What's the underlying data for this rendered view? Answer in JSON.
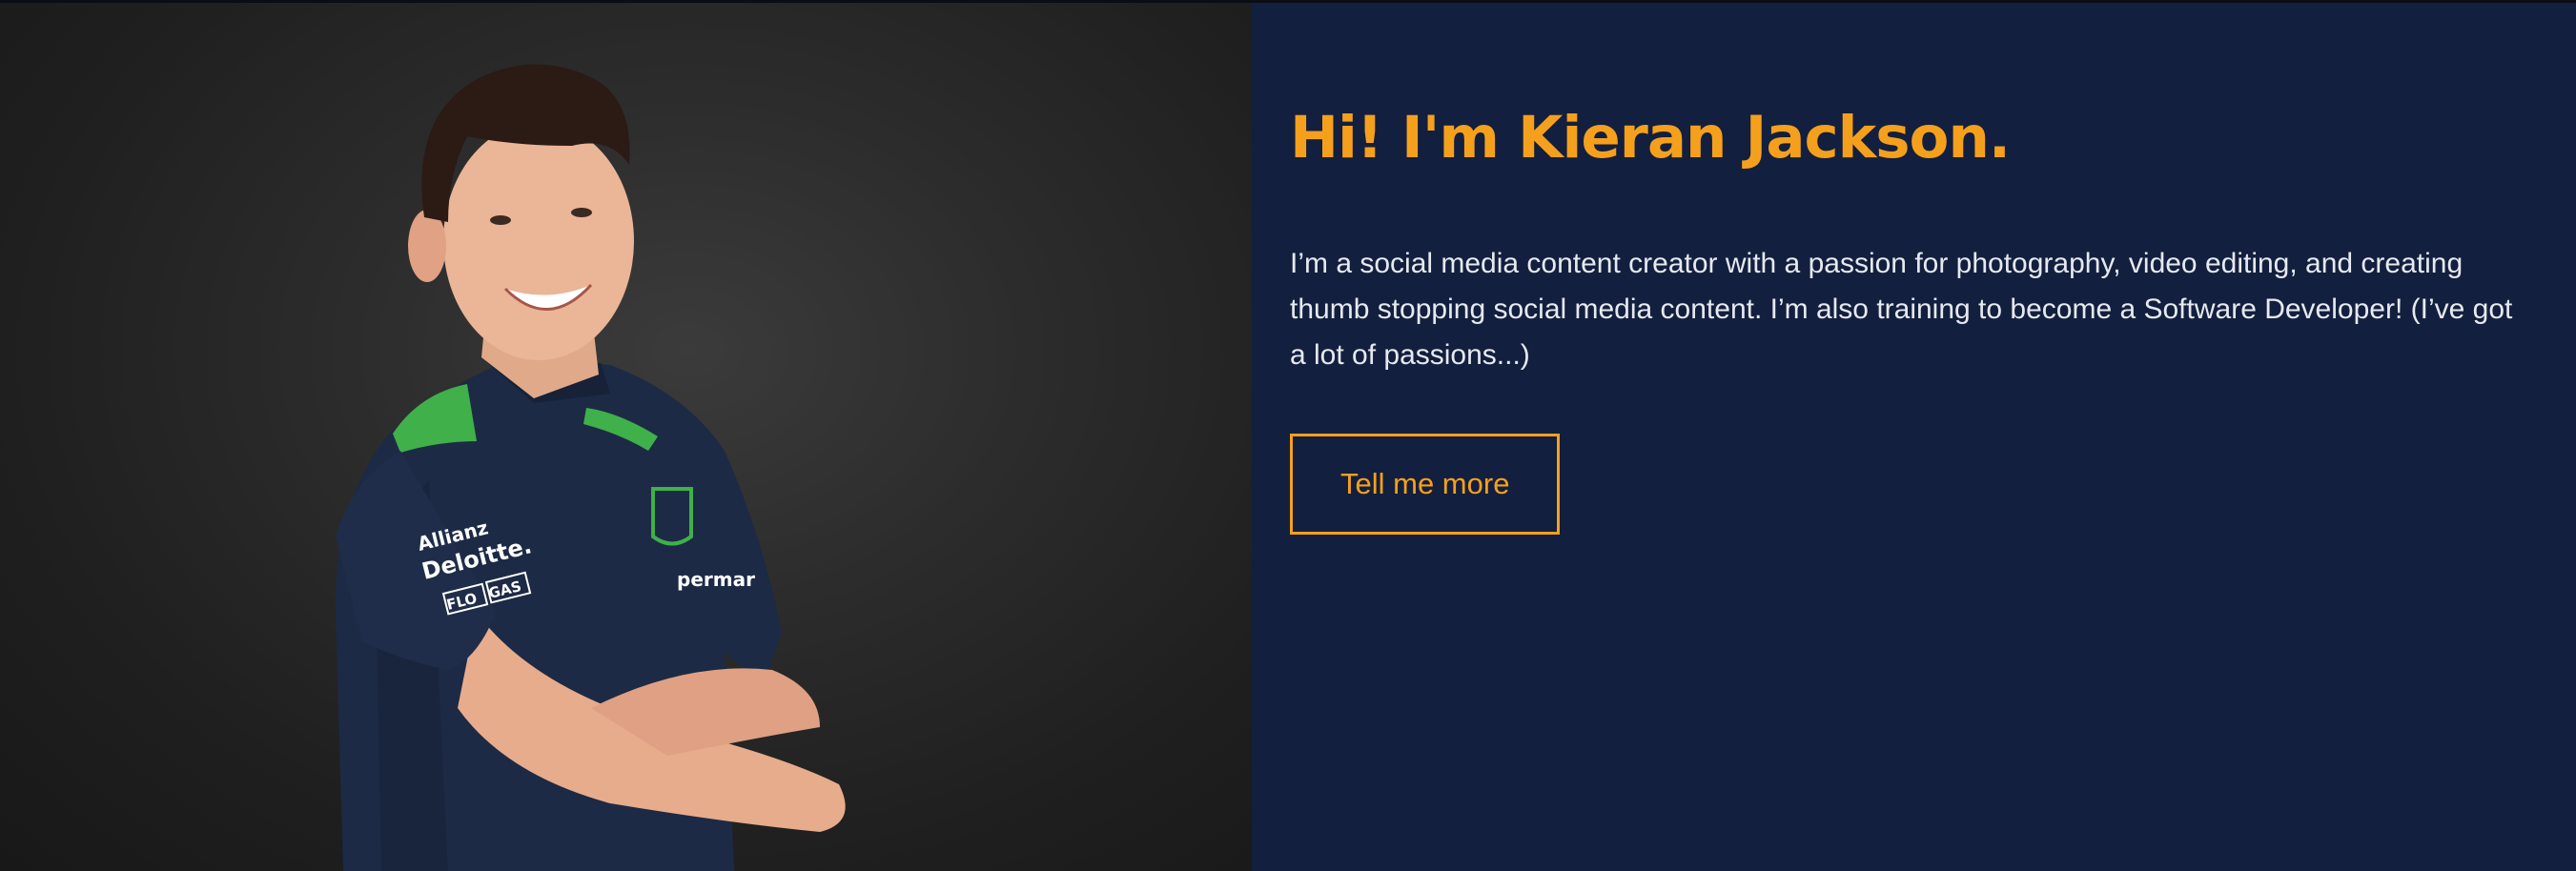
{
  "hero": {
    "headline": "Hi! I'm Kieran Jackson.",
    "intro": "I’m a social media content creator with a passion for photography, video editing, and creating thumb stopping social media content. I’m also training to become a Software Developer! (I’ve got a lot of passions...)",
    "cta_label": "Tell me more"
  },
  "photo": {
    "shirt_sponsors": [
      "Allianz",
      "Deloitte.",
      "FLO",
      "GAS",
      "permar"
    ]
  },
  "colors": {
    "accent": "#f5a01d",
    "panel_background": "#131f3e",
    "photo_background": "#2c2c2c",
    "body_text": "#e6e9f0"
  }
}
